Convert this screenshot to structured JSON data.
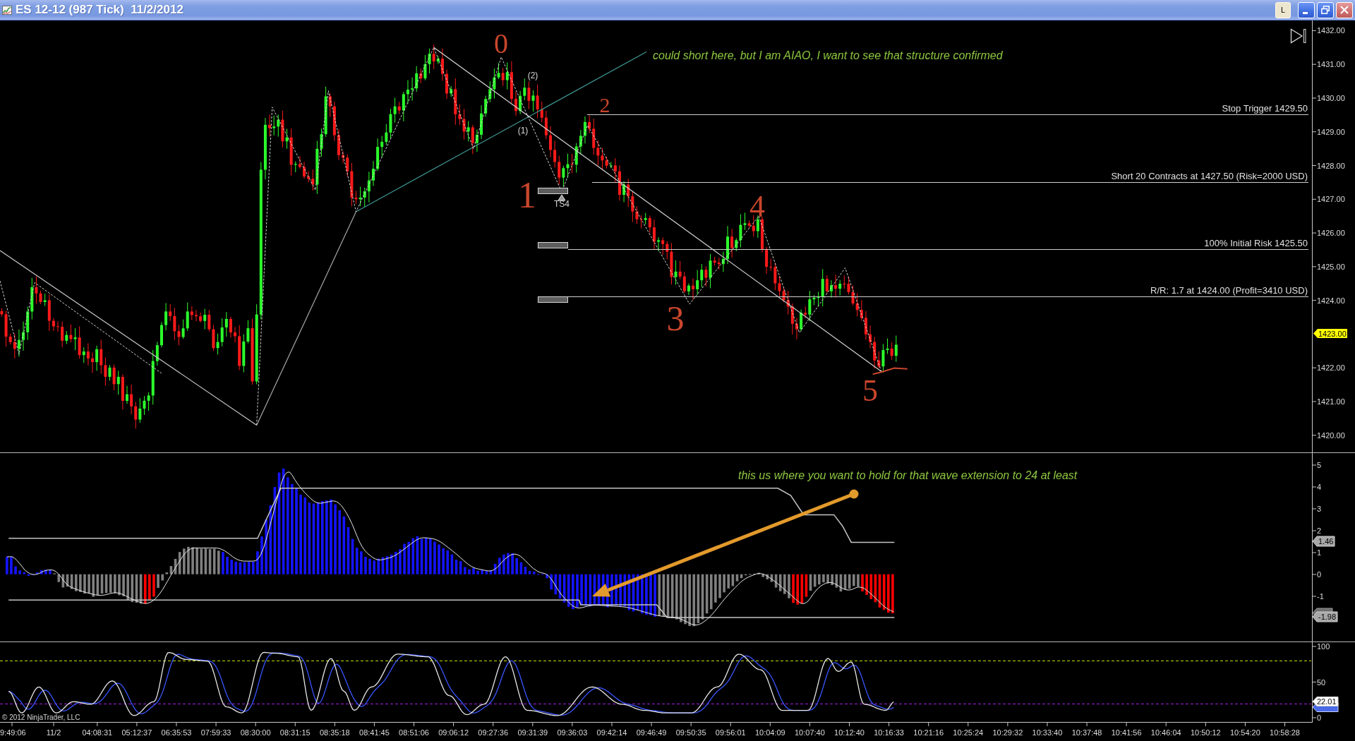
{
  "window": {
    "title": "ES 12-12 (987 Tick)  11/2/2012",
    "buttons": [
      {
        "kind": "text",
        "label": "L"
      },
      {
        "kind": "minimize"
      },
      {
        "kind": "restore"
      },
      {
        "kind": "close"
      }
    ]
  },
  "price_panel": {
    "axis_labels": [
      "1432.00",
      "1431.00",
      "1430.00",
      "1429.00",
      "1428.00",
      "1427.00",
      "1426.00",
      "1425.00",
      "1424.00",
      "1422.00",
      "1421.00",
      "1420.00"
    ],
    "last_price_tag": "1423.00",
    "level_labels": [
      "Stop Trigger 1429.50",
      "Short 20 Contracts at 1427.50 (Risk=2000 USD)",
      "100% Initial Risk 1425.50",
      "R/R: 1.7 at 1424.00 (Profit=3410 USD)"
    ],
    "wave_labels": [
      "0",
      "1",
      "2",
      "3",
      "4",
      "5"
    ],
    "swing_labels": [
      "(1)",
      "(2)"
    ],
    "marker_label": "TS4",
    "note": "could short here, but I am AIAO, I want to see that structure confirmed"
  },
  "oscillator_panel": {
    "axis_labels": [
      "5",
      "4",
      "3",
      "2",
      "1",
      "0",
      "-1"
    ],
    "value_tags": [
      "1.46",
      "-1.98"
    ],
    "note": "this us where you want to hold for that wave extension to 24 at least"
  },
  "stochastic_panel": {
    "axis_labels": [
      "100",
      "50",
      "0"
    ],
    "value_tag": "22.01",
    "copyright": "© 2012 NinjaTrader, LLC"
  },
  "time_axis": {
    "labels": [
      "9:49:06",
      "11/2",
      "04:08:31",
      "05:12:37",
      "06:35:53",
      "07:59:33",
      "08:30:00",
      "08:31:15",
      "08:35:18",
      "08:41:45",
      "08:51:06",
      "09:06:12",
      "09:27:36",
      "09:31:39",
      "09:36:03",
      "09:42:14",
      "09:46:49",
      "09:50:35",
      "09:56:01",
      "10:04:09",
      "10:07:40",
      "10:12:40",
      "10:16:33",
      "10:21:16",
      "10:25:24",
      "10:29:32",
      "10:33:40",
      "10:37:48",
      "10:41:56",
      "10:46:04",
      "10:50:12",
      "10:54:20",
      "10:58:28"
    ]
  }
}
